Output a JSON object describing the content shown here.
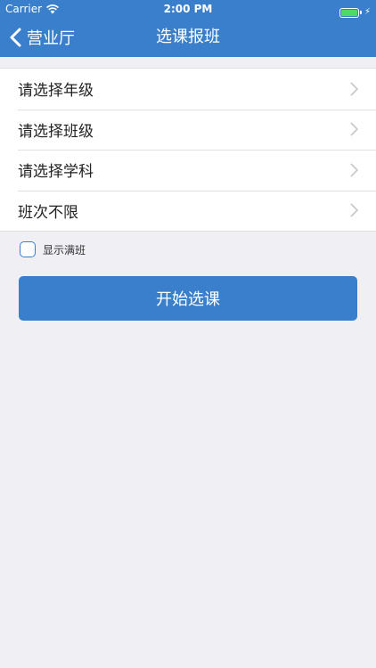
{
  "status_bar": {
    "carrier": "Carrier",
    "time": "2:00 PM"
  },
  "nav": {
    "back_label": "营业厅",
    "title": "选课报班"
  },
  "filters": [
    {
      "label": "请选择年级"
    },
    {
      "label": "请选择班级"
    },
    {
      "label": "请选择学科"
    },
    {
      "label": "班次不限"
    }
  ],
  "show_full_classes": {
    "label": "显示满班",
    "checked": false
  },
  "start_button": {
    "label": "开始选课"
  },
  "colors": {
    "accent": "#3a7fcb",
    "background": "#efeff4"
  }
}
